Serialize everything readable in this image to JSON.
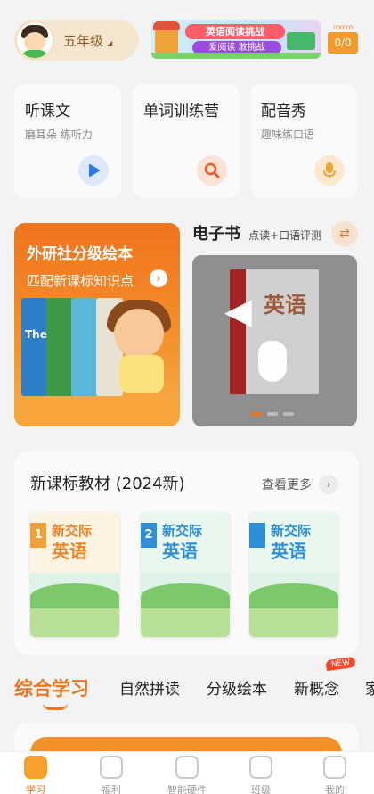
{
  "header": {
    "grade": "五年级",
    "banner_title": "英语阅读挑战",
    "banner_subtitle": "爱阅读 敢挑战",
    "counter": "0/0"
  },
  "features": [
    {
      "title": "听课文",
      "subtitle": "磨耳朵 练听力",
      "icon": "play-icon",
      "icon_color": "#2f7be6"
    },
    {
      "title": "单词训练营",
      "subtitle": "",
      "icon": "search-icon",
      "icon_color": "#e95b2b"
    },
    {
      "title": "配音秀",
      "subtitle": "趣味练口语",
      "icon": "microphone-icon",
      "icon_color": "#f0a43a"
    }
  ],
  "promo": {
    "title": "外研社分级绘本",
    "subtitle": "匹配新课标知识点",
    "book_label": "The"
  },
  "ebook": {
    "title": "电子书",
    "subtitle": "点读+口语评测",
    "cover_text": "英语"
  },
  "textbooks": {
    "title": "新课标教材 (2024新)",
    "more": "查看更多",
    "books": [
      {
        "number": "1",
        "line1": "新交际",
        "line2": "英语",
        "color": "#f0a23a"
      },
      {
        "number": "2",
        "line1": "新交际",
        "line2": "英语",
        "color": "#2f8fd6"
      },
      {
        "number": "",
        "line1": "新交际",
        "line2": "英语",
        "color": "#2f8fd6"
      }
    ]
  },
  "tabs": {
    "items": [
      "综合学习",
      "自然拼读",
      "分级绘本",
      "新概念",
      "家"
    ],
    "badge": "NEW"
  },
  "nav": {
    "items": [
      "学习",
      "福利",
      "智能硬件",
      "班级",
      "我的"
    ]
  },
  "colors": {
    "accent": "#f0731e"
  }
}
